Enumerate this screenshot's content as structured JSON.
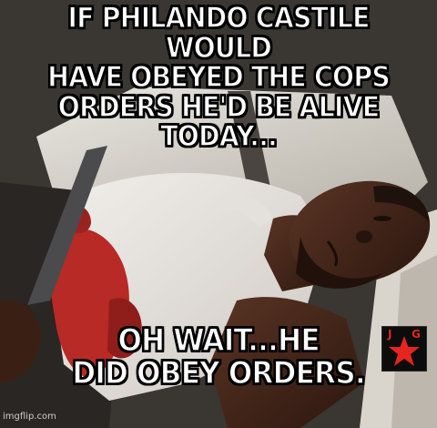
{
  "meme": {
    "top_caption": [
      "IF PHILANDO CASTILE WOULD",
      "HAVE OBEYED THE COPS",
      "ORDERS HE'D BE ALIVE TODAY..."
    ],
    "bottom_caption": [
      "OH WAIT...HE",
      "DID OBEY ORDERS."
    ],
    "badge": {
      "letter_left": "J",
      "letter_right": "G",
      "icon": "red-star-icon"
    },
    "watermark": "imgflip.com"
  },
  "colors": {
    "caption_text": "#ffffff",
    "caption_outline": "#000000",
    "badge_background": "#0c0c0c",
    "badge_accent": "#e52520",
    "blood_red": "#b82a25",
    "shirt_white": "#e9e6e2",
    "skin": "#3e2418"
  }
}
